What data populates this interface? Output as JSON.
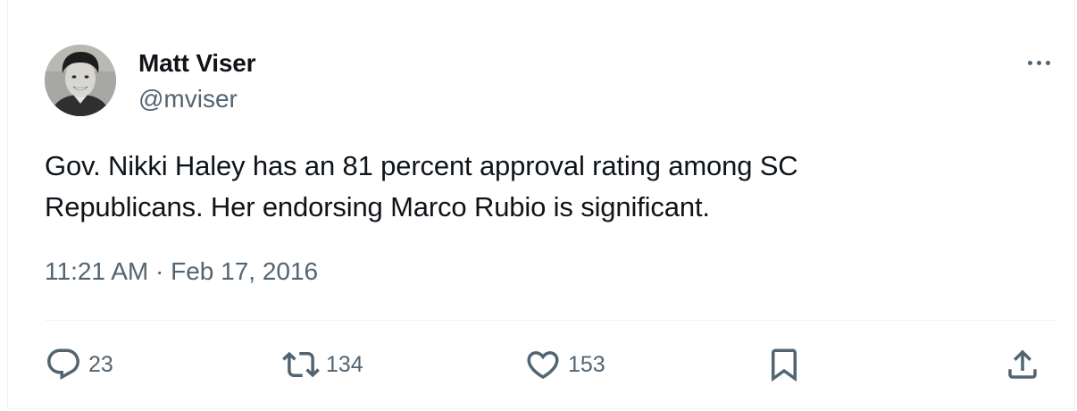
{
  "author": {
    "name": "Matt Viser",
    "handle": "@mviser"
  },
  "tweet": {
    "text_line1": "Gov. Nikki Haley has an 81 percent approval rating among SC",
    "text_line2": "Republicans. Her endorsing Marco Rubio is significant.",
    "timestamp": "11:21 AM · Feb 17, 2016"
  },
  "actions": {
    "replies": "23",
    "reposts": "134",
    "likes": "153"
  },
  "icons": {
    "more": "more-horizontal-icon",
    "reply": "speech-bubble-icon",
    "repost": "repost-arrows-icon",
    "like": "heart-icon",
    "bookmark": "bookmark-icon",
    "share": "share-upload-icon"
  },
  "colors": {
    "text_primary": "#0f1419",
    "text_secondary": "#536471",
    "divider": "#eff3f4"
  }
}
